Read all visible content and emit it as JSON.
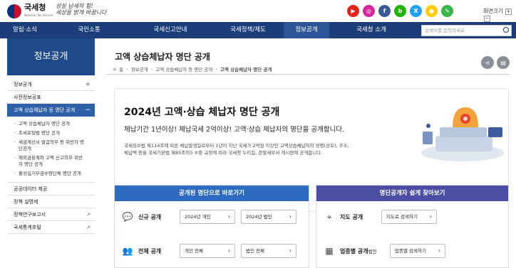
{
  "header": {
    "logo_text": "국세청",
    "logo_sub": "National Tax Service",
    "slogan_line1": "성실 납세의 힘!",
    "slogan_line2": "세상을 밝게 바꿉니다",
    "font_size_label": "화면크기",
    "font_plus": "+",
    "font_minus": "−",
    "sns": [
      {
        "name": "youtube-icon",
        "glyph": "▶",
        "color": "#e62117"
      },
      {
        "name": "instagram-icon",
        "glyph": "◎",
        "color": "#d6249f"
      },
      {
        "name": "facebook-icon",
        "glyph": "f",
        "color": "#3b5998"
      },
      {
        "name": "blog-icon",
        "glyph": "b",
        "color": "#1eb400"
      },
      {
        "name": "x-icon",
        "glyph": "X",
        "color": "#1da1f2"
      },
      {
        "name": "kakao-icon",
        "glyph": "●",
        "color": "#ffcd00"
      },
      {
        "name": "chat-icon",
        "glyph": "✎",
        "color": "#3ab54a"
      }
    ]
  },
  "gnb": {
    "items": [
      "알림·소식",
      "국민소통",
      "국세신고안내",
      "국세정책/제도",
      "정보공개",
      "국세청 소개"
    ],
    "active_index": 4,
    "search_placeholder": "검색어를 입력하세요"
  },
  "sidebar": {
    "title": "정보공개",
    "items": [
      {
        "label": "정보공개",
        "has_plus": true
      },
      {
        "label": "사전정보공표",
        "has_plus": false
      },
      {
        "label": "고액 상습체납자 등 명단 공개",
        "active": true
      }
    ],
    "sub_items": [
      "고액 상습체납자 명단 공개",
      "조세포탈범 명단 공개",
      "세금계산서 발급의무 등 위반자 명단공개",
      "해외금융계좌 고액 신고의무 위반자 명단 공개",
      "불성실기부금수령단체 명단 공개"
    ],
    "bottom_items": [
      {
        "label": "공공데이터 제공",
        "ext": false
      },
      {
        "label": "정책 실명제",
        "ext": false
      },
      {
        "label": "정책연구보고서",
        "ext": true
      },
      {
        "label": "국세통계포털",
        "ext": true
      }
    ]
  },
  "main": {
    "title": "고액 상습체납자 명단 공개",
    "breadcrumb": [
      "홈",
      "정보공개",
      "고액 상습체납자 등 명단 공개",
      "고액 상습체납자 명단 공개"
    ],
    "hero": {
      "title": "2024년 고액·상습 체납자 명단 공개",
      "subtitle": "체납기간 1년이상! 체납국세 2억이상! 고액·상습 체납자의 명단을 공개합니다.",
      "desc1": "국세징수법 제114조에 따른 체납발생일로부터 1년이 지난 국세가 2억원 이상인 고액상습체납자의 성명(상호), 주소,",
      "desc2": "체납액 등을 국세기본법 제85조의5 ⑤항 규정에 따라 국세청 누리집, 관할세무서 게시판에 공개합니다."
    },
    "card_left": {
      "header": "공개된 명단으로 바로가기",
      "header_color": "#2e6bc0",
      "row1_label": "신규 공개",
      "row1_btn1": "2024년 개인",
      "row1_btn2": "2024년 법인",
      "row2_label": "전체 공개",
      "row2_btn1": "개인 전체",
      "row2_btn2": "법인 전체"
    },
    "card_right": {
      "header": "명단공개자 쉽게 찾아보기",
      "header_color": "#4b4ea3",
      "row1_label": "지도 공개",
      "row1_btn": "지도로 검색하기",
      "row2_label": "업종별 공개",
      "row2_suffix": "법인",
      "row2_btn": "업종별 검색하기"
    }
  }
}
